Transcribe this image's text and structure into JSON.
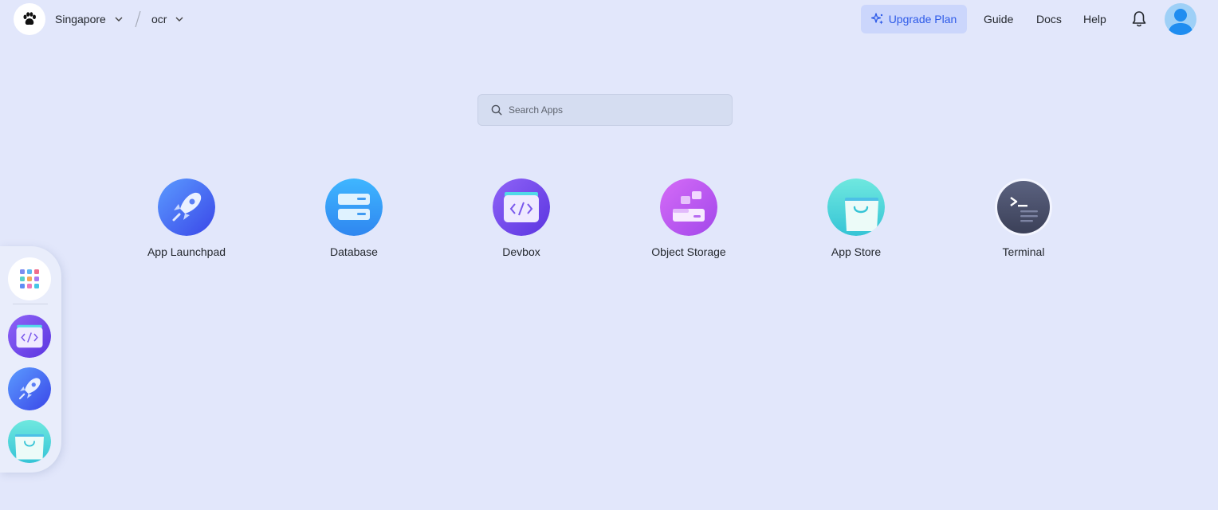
{
  "header": {
    "region": "Singapore",
    "namespace": "ocr",
    "upgrade_label": "Upgrade Plan",
    "links": [
      "Guide",
      "Docs",
      "Help"
    ]
  },
  "search": {
    "placeholder": "Search Apps"
  },
  "apps": [
    {
      "label": "App Launchpad",
      "icon": "rocket-icon"
    },
    {
      "label": "Database",
      "icon": "database-icon"
    },
    {
      "label": "Devbox",
      "icon": "devbox-icon"
    },
    {
      "label": "Object Storage",
      "icon": "object-storage-icon"
    },
    {
      "label": "App Store",
      "icon": "shopping-bag-icon"
    },
    {
      "label": "Terminal",
      "icon": "terminal-icon"
    }
  ],
  "dock": [
    "grid-icon",
    "devbox-icon",
    "rocket-icon",
    "shopping-bag-icon"
  ],
  "colors": {
    "background": "#e2e7fb",
    "accent": "#2d5ae8",
    "upgrade_bg": "#cbd6fc"
  }
}
